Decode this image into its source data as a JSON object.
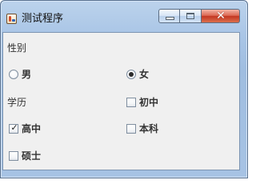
{
  "window": {
    "title": "测试程序",
    "controls": {
      "minimize_icon": "minimize-icon",
      "maximize_icon": "maximize-icon",
      "close_icon": "close-icon"
    }
  },
  "form": {
    "gender": {
      "label": "性别",
      "options": [
        {
          "label": "男",
          "selected": false
        },
        {
          "label": "女",
          "selected": true
        }
      ]
    },
    "education": {
      "label": "学历",
      "options": [
        {
          "label": "初中",
          "checked": false
        },
        {
          "label": "高中",
          "checked": true
        },
        {
          "label": "本科",
          "checked": false
        },
        {
          "label": "硕士",
          "checked": false
        }
      ]
    }
  },
  "colors": {
    "title_bar": "#a7c3e4",
    "panel_background": "#f0f0f0",
    "close_button": "#c33722"
  }
}
